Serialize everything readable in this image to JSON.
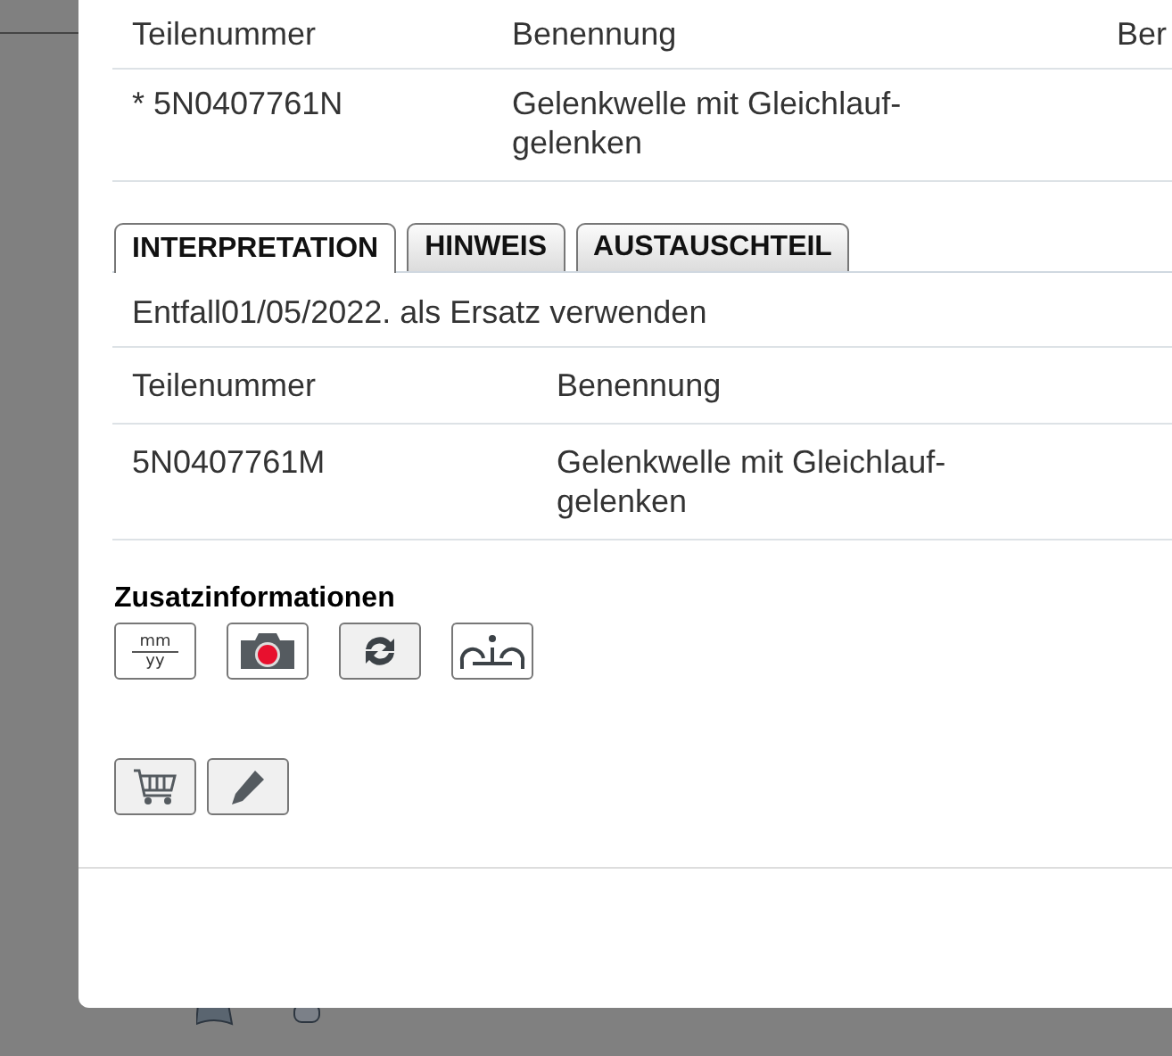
{
  "parts_table": {
    "columns": [
      "Teilenummer",
      "Benennung",
      "Ber"
    ],
    "rows": [
      {
        "cells": [
          "* 5N0407761N",
          "Gelenkwelle mit Gleichlauf-gelenken"
        ]
      }
    ]
  },
  "tabs": [
    {
      "label": "INTERPRETATION",
      "selected": true
    },
    {
      "label": "HINWEIS",
      "selected": false
    },
    {
      "label": "AUSTAUSCHTEIL",
      "selected": false
    }
  ],
  "interpretation": {
    "note": "Entfall01/05/2022. als Ersatz verwenden",
    "columns": [
      "Teilenummer",
      "Benennung"
    ],
    "rows": [
      {
        "cells": [
          "5N0407761M",
          "Gelenkwelle mit Gleichlauf-gelenken"
        ]
      }
    ]
  },
  "additional_info": {
    "title": "Zusatzinformationen",
    "buttons": [
      {
        "kind": "date",
        "top": "mm",
        "bottom": "yy"
      },
      {
        "kind": "camera"
      },
      {
        "kind": "refresh"
      },
      {
        "kind": "info"
      }
    ]
  },
  "actions": [
    {
      "kind": "cart"
    },
    {
      "kind": "edit"
    }
  ]
}
